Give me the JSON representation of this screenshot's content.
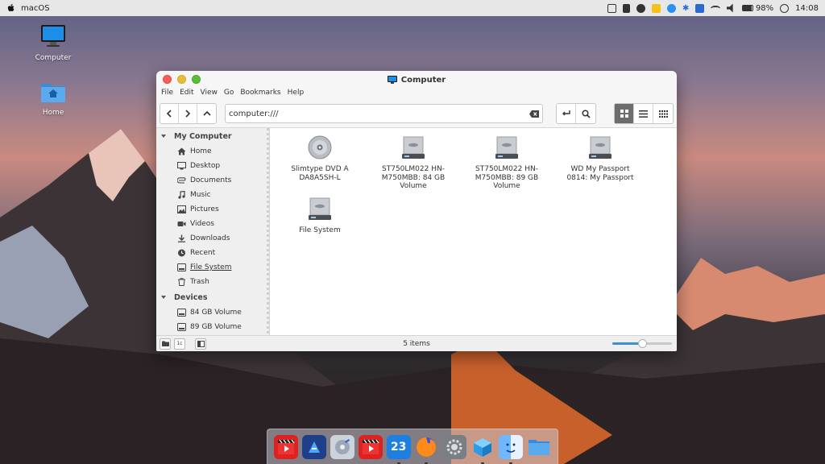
{
  "topbar": {
    "os_title": "macOS",
    "battery": "98%",
    "clock": "14:08"
  },
  "desktop": {
    "icons": [
      {
        "label": "Computer"
      },
      {
        "label": "Home"
      }
    ]
  },
  "window": {
    "title": "Computer",
    "menu": [
      "File",
      "Edit",
      "View",
      "Go",
      "Bookmarks",
      "Help"
    ],
    "location": "computer:///",
    "sidebar": {
      "my_computer": {
        "heading": "My Computer",
        "items": [
          "Home",
          "Desktop",
          "Documents",
          "Music",
          "Pictures",
          "Videos",
          "Downloads",
          "Recent",
          "File System",
          "Trash"
        ]
      },
      "devices": {
        "heading": "Devices",
        "items": [
          "84 GB Volume",
          "89 GB Volume"
        ]
      }
    },
    "files": [
      {
        "label": "Slimtype DVD A DA8A5SH-L",
        "kind": "optical"
      },
      {
        "label": "ST750LM022 HN-M750MBB: 84 GB Volume",
        "kind": "drive"
      },
      {
        "label": "ST750LM022 HN-M750MBB: 89 GB Volume",
        "kind": "drive"
      },
      {
        "label": "WD My Passport 0814: My Passport",
        "kind": "drive"
      },
      {
        "label": "File System",
        "kind": "drive"
      }
    ],
    "status": {
      "items_count": "5 items",
      "zoom_level": 0.5,
      "button_2_label": "1c"
    }
  },
  "dock": {
    "calendar_day": "23",
    "apps": [
      "video-player",
      "video-editor",
      "disk-utility",
      "video-player-2",
      "calendar",
      "firefox",
      "system-preferences",
      "cube-app",
      "finder",
      "folder"
    ]
  },
  "colors": {
    "close": "#fc5b57",
    "minimize": "#e5bf3c",
    "zoom": "#57c038",
    "accent": "#3d8fdc"
  }
}
